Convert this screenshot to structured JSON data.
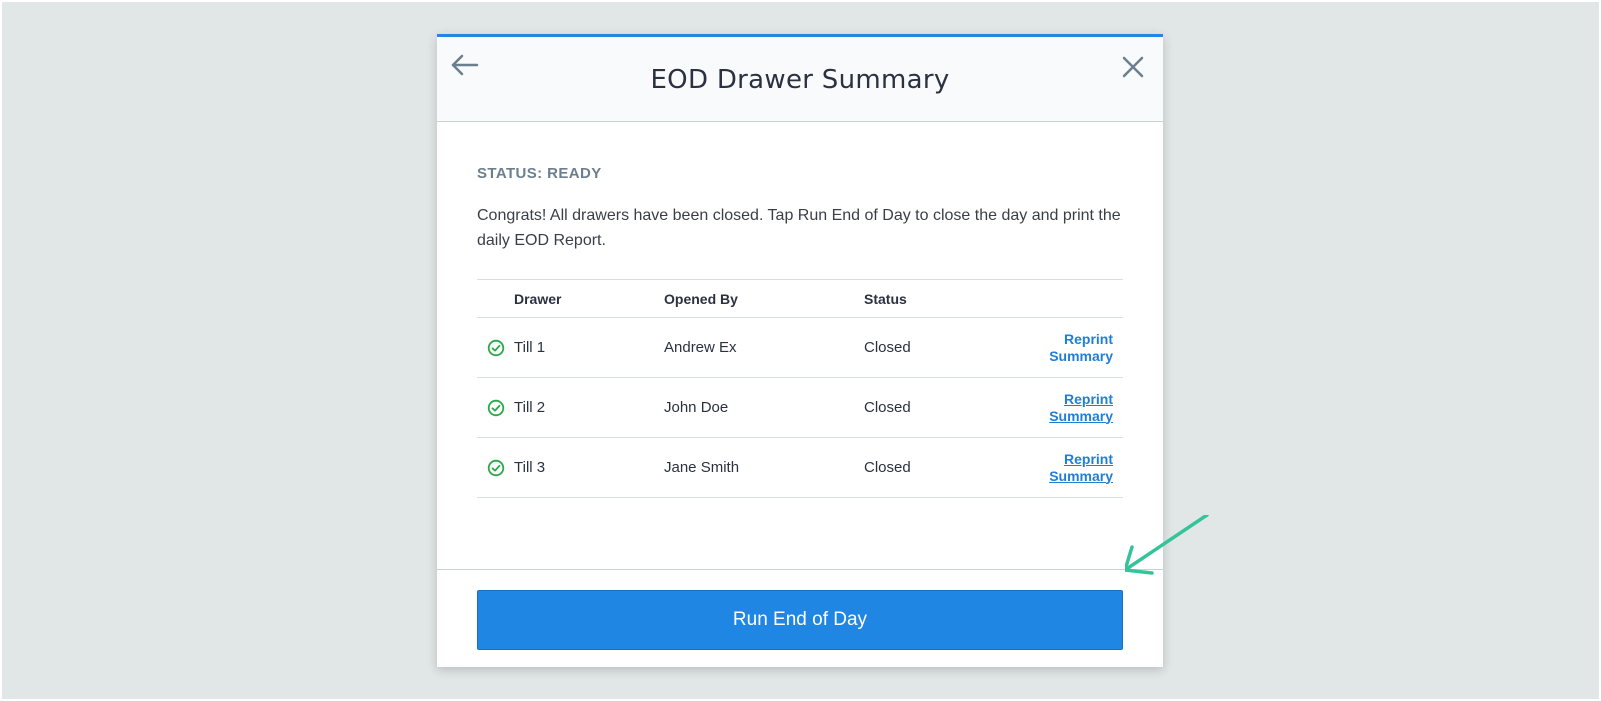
{
  "modal": {
    "title": "EOD Drawer Summary",
    "status_label": "STATUS: READY",
    "description": "Congrats! All drawers have been closed. Tap Run End of Day to close the day and print the daily EOD Report.",
    "primary_button_label": "Run End of Day"
  },
  "table": {
    "headers": {
      "drawer": "Drawer",
      "opened_by": "Opened By",
      "status": "Status"
    },
    "rows": [
      {
        "drawer": "Till 1",
        "opened_by": "Andrew Ex",
        "status": "Closed",
        "action": "Reprint Summary"
      },
      {
        "drawer": "Till 2",
        "opened_by": "John Doe",
        "status": "Closed",
        "action": "Reprint Summary"
      },
      {
        "drawer": "Till 3",
        "opened_by": "Jane Smith",
        "status": "Closed",
        "action": "Reprint Summary"
      }
    ]
  },
  "icons": {
    "back": "arrow-left-icon",
    "close": "close-icon",
    "row_status": "check-circle-icon"
  },
  "colors": {
    "accent": "#1f86e3",
    "link": "#1f7fd6",
    "success": "#2aa84a",
    "annotation": "#35c49a",
    "background": "#e1e7e6"
  }
}
